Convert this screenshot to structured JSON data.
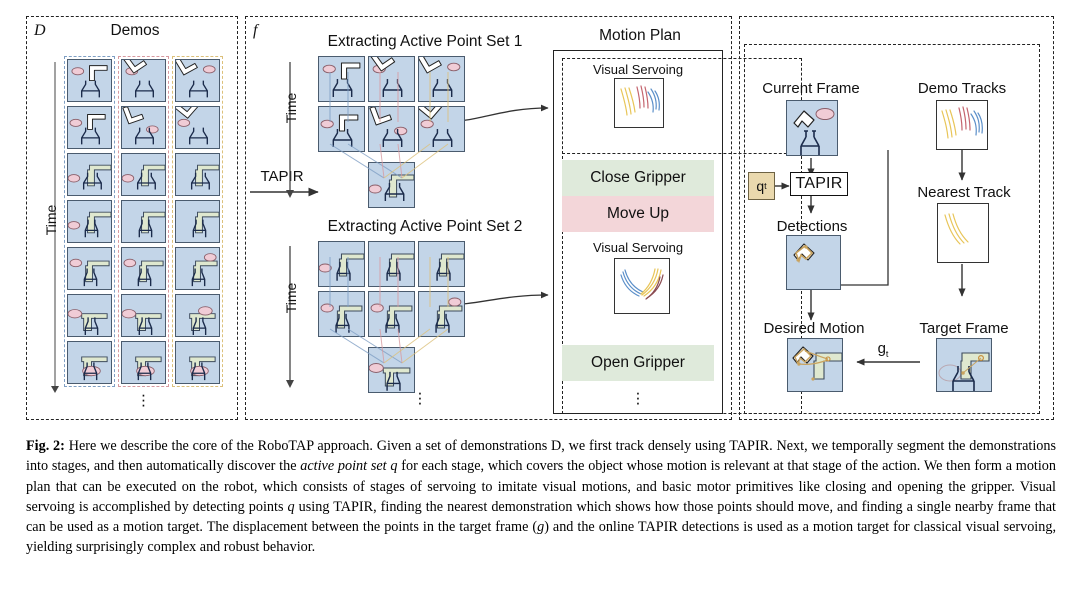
{
  "figure": {
    "panels": {
      "demos": {
        "label": "D",
        "title": "Demos",
        "time_label": "Time"
      },
      "extract": {
        "label": "f",
        "set1_title": "Extracting Active Point Set 1",
        "set2_title": "Extracting Active Point Set 2",
        "tapir_arrow_label": "TAPIR",
        "time_label_1": "Time",
        "time_label_2": "Time"
      },
      "motion_plan": {
        "title": "Motion Plan",
        "steps": [
          {
            "kind": "servo",
            "label": "Visual Servoing"
          },
          {
            "kind": "primitive",
            "label": "Close Gripper",
            "color": "#dfeadb"
          },
          {
            "kind": "primitive",
            "label": "Move Up",
            "color": "#f3d6d9"
          },
          {
            "kind": "servo",
            "label": "Visual Servoing"
          },
          {
            "kind": "primitive",
            "label": "Open Gripper",
            "color": "#dfeadb"
          }
        ],
        "ellipsis": "⋮"
      },
      "servo_detail": {
        "current_frame": "Current Frame",
        "demo_tracks": "Demo Tracks",
        "q_token": "q",
        "q_subscript": "t",
        "tapir": "TAPIR",
        "detections": "Detections",
        "nearest_track": "Nearest Track",
        "desired_motion": "Desired Motion",
        "target_frame": "Target Frame",
        "g_token": "g",
        "g_subscript": "t"
      }
    },
    "colors": {
      "frame_fill": "#c3d5e8",
      "frame_stroke": "#4a5b6e",
      "demo_col_1": "#7f9fc4",
      "demo_col_2": "#d79aa0",
      "demo_col_3": "#dcc07a",
      "track_yellow": "#e8c558",
      "track_red": "#c4646e",
      "track_blue": "#5b8fc9",
      "band_green": "#dfeadb",
      "band_pink": "#f3d6d9",
      "q_box": "#ead9ae",
      "object_green": "#dfe8cf",
      "object_pink": "#f0ccd6"
    }
  },
  "caption": {
    "prefix": "Fig. 2:",
    "text_1": " Here we describe the core of the RoboTAP approach. Given a set of demonstrations D, we first track densely using TAPIR. Next, we temporally segment the demonstrations into stages, and then automatically discover the ",
    "italic_1": "active point set q",
    "text_2": " for each stage, which covers the object whose motion is relevant at that stage of the action. We then form a motion plan that can be executed on the robot, which consists of stages of servoing to imitate visual motions, and basic motor primitives like closing and opening the gripper. Visual servoing is accomplished by detecting points ",
    "italic_2": "q",
    "text_3": " using TAPIR, finding the nearest demonstration which shows how those points should move, and finding a single nearby frame that can be used as a motion target. The displacement between the points in the target frame (",
    "italic_3": "g",
    "text_4": ") and the online TAPIR detections is used as a motion target for classical visual servoing, yielding surprisingly complex and robust behavior."
  }
}
